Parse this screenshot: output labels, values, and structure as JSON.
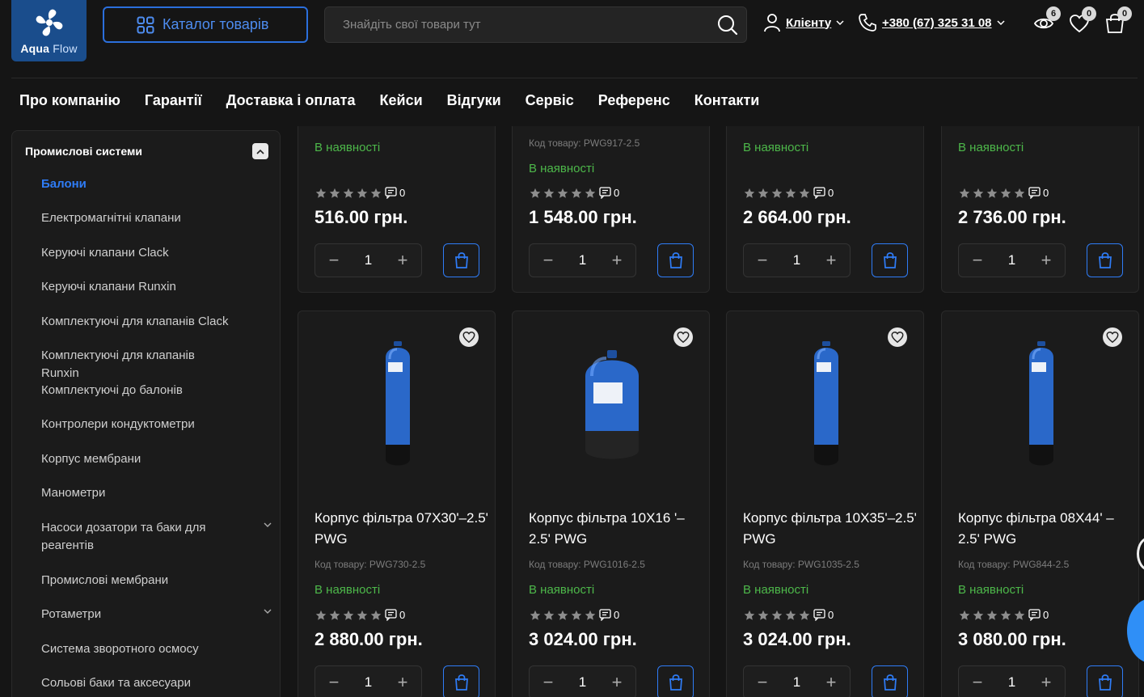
{
  "header": {
    "logo_line1": "Aqua",
    "logo_line2": "Flow",
    "catalog_label": "Каталог товарів",
    "search_placeholder": "Знайдіть свої товари тут",
    "client_label": "Клієнту",
    "phone": "+380 (67) 325 31 08",
    "viewed_count": "6",
    "wishlist_count": "0",
    "cart_count": "0"
  },
  "nav": [
    "Про компанію",
    "Гарантії",
    "Доставка і оплата",
    "Кейси",
    "Відгуки",
    "Сервіс",
    "Референс",
    "Контакти"
  ],
  "sidebar": {
    "heading": "Промислові системи",
    "items": [
      {
        "label": "Балони",
        "active": true
      },
      {
        "label": "Електромагнітні клапани"
      },
      {
        "label": "Керуючі клапани Clack"
      },
      {
        "label": "Керуючі клапани Runxin"
      },
      {
        "label": "Комплектуючі для клапанів Clack"
      },
      {
        "label": "Комплектуючі для клапанів Runxin"
      },
      {
        "label": "Комплектуючі до балонів"
      },
      {
        "label": "Контролери кондуктометри"
      },
      {
        "label": "Корпус мембрани"
      },
      {
        "label": "Манометри"
      },
      {
        "label": "Насоси дозатори та баки для реагентів",
        "expandable": true
      },
      {
        "label": "Промислові мембрани"
      },
      {
        "label": "Ротаметри",
        "expandable": true
      },
      {
        "label": "Система зворотного осмосу"
      },
      {
        "label": "Сольові баки та аксесуари"
      }
    ]
  },
  "top_row": [
    {
      "code": "",
      "stock": "В наявності",
      "reviews": "0",
      "price": "516.00 грн.",
      "qty": "1"
    },
    {
      "code": "Код товару: PWG917-2.5",
      "stock": "В наявності",
      "reviews": "0",
      "price": "1 548.00 грн.",
      "qty": "1"
    },
    {
      "code": "",
      "stock": "В наявності",
      "reviews": "0",
      "price": "2 664.00 грн.",
      "qty": "1"
    },
    {
      "code": "",
      "stock": "В наявності",
      "reviews": "0",
      "price": "2 736.00 грн.",
      "qty": "1"
    }
  ],
  "products": [
    {
      "name": "Корпус фільтра 07X30'–2.5' PWG",
      "code": "Код товару: PWG730-2.5",
      "stock": "В наявності",
      "reviews": "0",
      "price": "2 880.00 грн.",
      "qty": "1",
      "shape": "tall"
    },
    {
      "name": "Корпус фільтра 10X16 '–2.5' PWG",
      "code": "Код товару: PWG1016-2.5",
      "stock": "В наявності",
      "reviews": "0",
      "price": "3 024.00 грн.",
      "qty": "1",
      "shape": "short"
    },
    {
      "name": "Корпус фільтра 10X35'–2.5' PWG",
      "code": "Код товару: PWG1035-2.5",
      "stock": "В наявності",
      "reviews": "0",
      "price": "3 024.00 грн.",
      "qty": "1",
      "shape": "tall"
    },
    {
      "name": "Корпус фільтра 08X44' –2.5' PWG",
      "code": "Код товару: PWG844-2.5",
      "stock": "В наявності",
      "reviews": "0",
      "price": "3 080.00 грн.",
      "qty": "1",
      "shape": "tall"
    }
  ],
  "colors": {
    "accent": "#2f7cf6",
    "stock": "#4db84a",
    "background": "#151515"
  }
}
